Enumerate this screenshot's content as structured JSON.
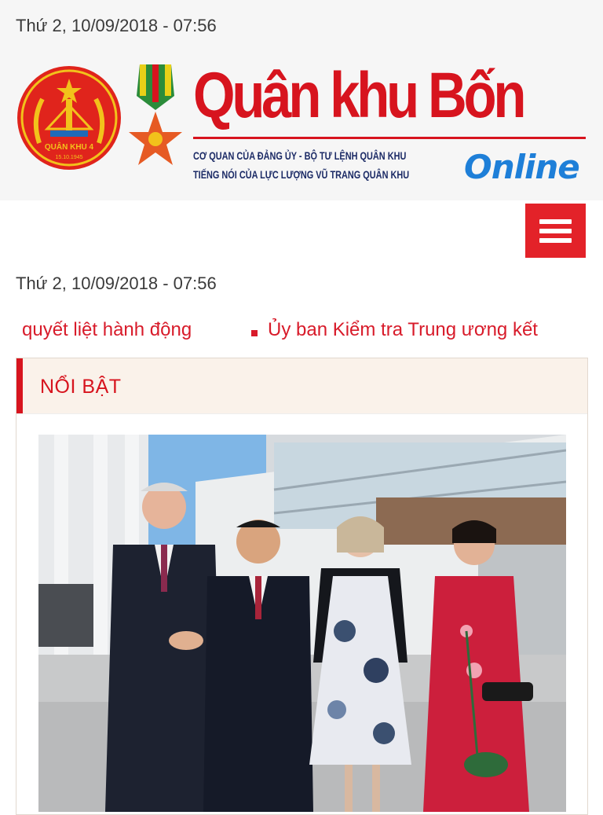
{
  "header": {
    "date_time": "Thứ 2, 10/09/2018 - 07:56",
    "site_name": "Quân khu Bốn",
    "tagline_1": "CƠ QUAN CỦA ĐẢNG ỦY - BỘ TƯ LỆNH QUÂN KHU",
    "tagline_2": "TIẾNG NÓI CỦA LỰC LƯỢNG VŨ TRANG QUÂN KHU",
    "online_label": "Online",
    "emblem_text": "QUÂN KHU 4",
    "emblem_date": "15.10.1945"
  },
  "nav": {
    "menu_icon": "hamburger-menu-icon"
  },
  "date_secondary": "Thứ 2, 10/09/2018 - 07:56",
  "ticker": {
    "items": [
      "quyết liệt hành động",
      "Ủy ban Kiểm tra Trung ương kết"
    ]
  },
  "featured": {
    "section_title": "NỔI BẬT"
  },
  "colors": {
    "brand_red": "#d7141e",
    "online_blue": "#1e7fd8",
    "tagline_navy": "#1c2b66",
    "section_bg": "#faf2ea"
  }
}
